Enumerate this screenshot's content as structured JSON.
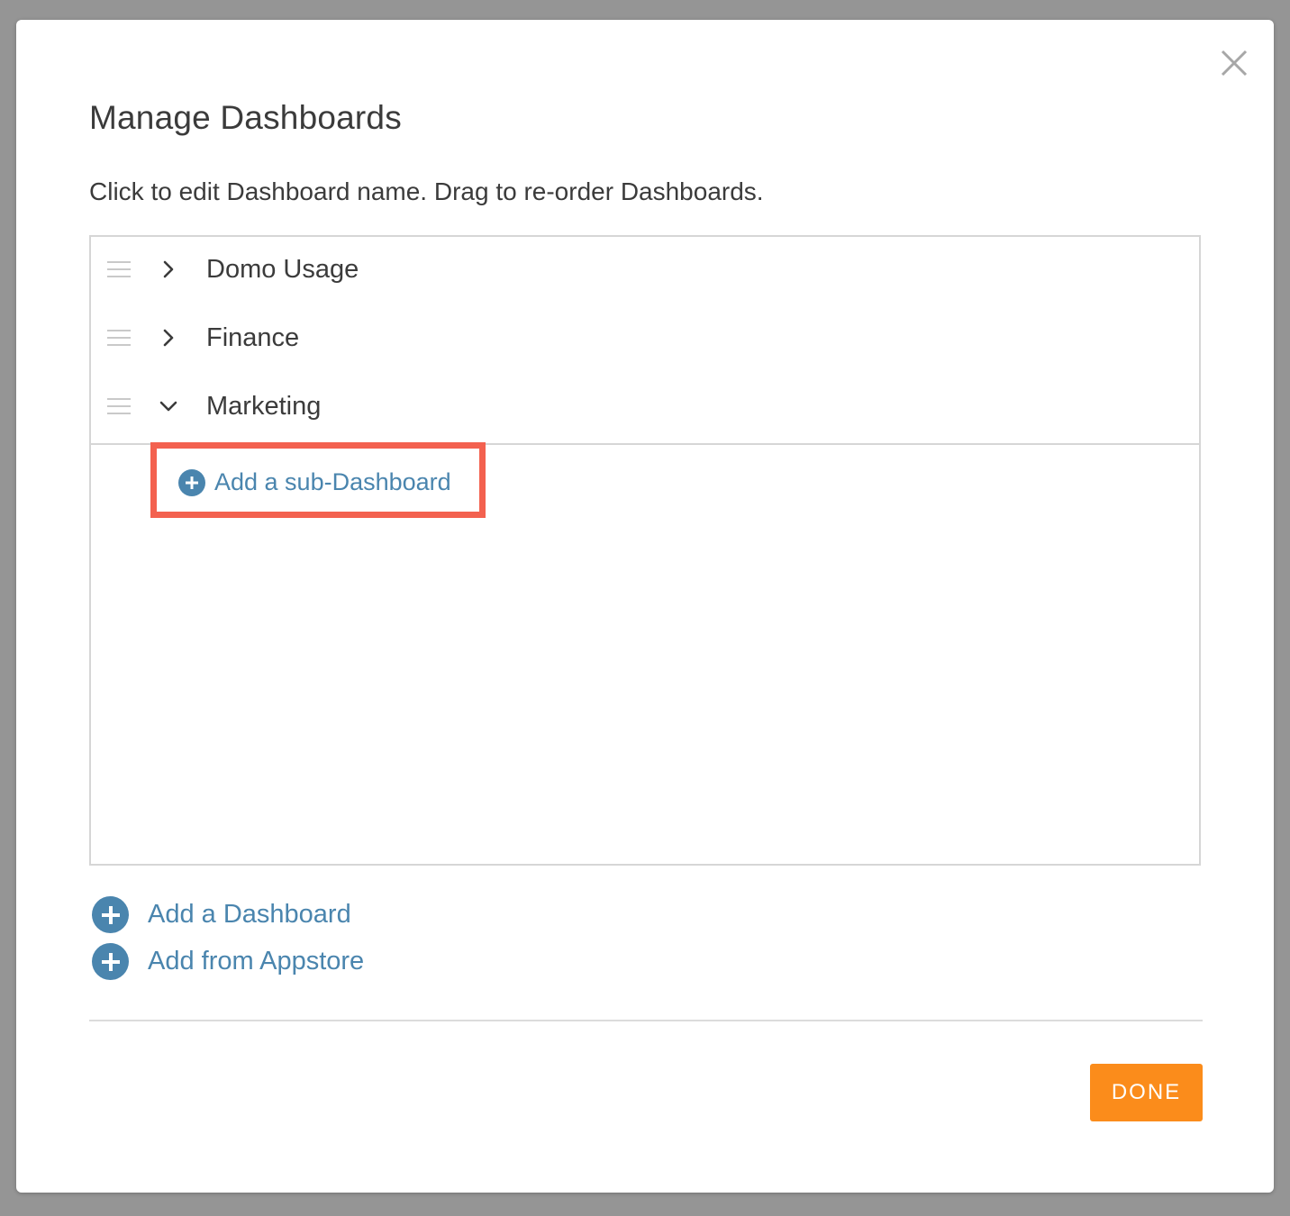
{
  "dialog": {
    "title": "Manage Dashboards",
    "instructions": "Click to edit Dashboard name. Drag to re-order Dashboards."
  },
  "dashboards": [
    {
      "name": "Domo Usage",
      "expanded": false
    },
    {
      "name": "Finance",
      "expanded": false
    },
    {
      "name": "Marketing",
      "expanded": true
    }
  ],
  "sub_dashboard": {
    "add_label": "Add a sub-Dashboard",
    "highlight_color": "#f3614f"
  },
  "actions": {
    "add_dashboard_label": "Add a Dashboard",
    "add_from_appstore_label": "Add from Appstore"
  },
  "footer": {
    "done_label": "DONE"
  },
  "colors": {
    "accent": "#4a85ae",
    "done_button": "#fb8c1b",
    "text": "#3b3b3b",
    "overlay": "#959595"
  },
  "icons": {
    "close": "close-icon",
    "drag": "drag-handle-icon",
    "collapsed": "chevron-right-icon",
    "expanded": "chevron-down-icon",
    "add": "plus-circle-icon"
  }
}
